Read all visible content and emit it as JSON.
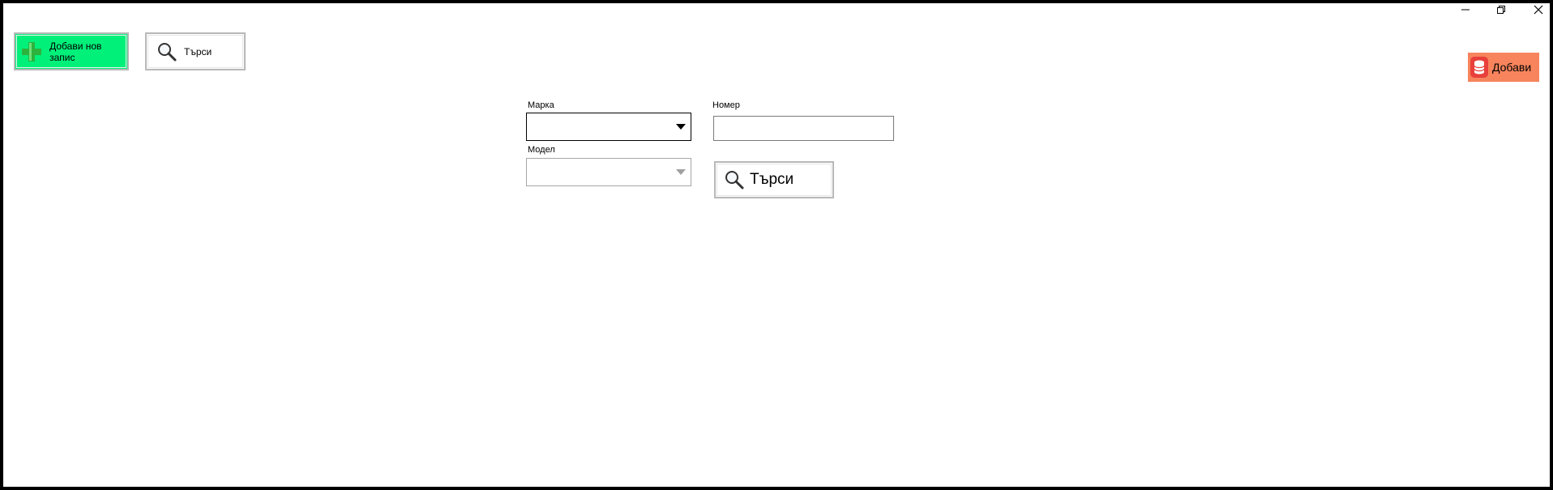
{
  "window": {
    "controls": {
      "minimize": "–",
      "restore": "❐",
      "close": "✕"
    }
  },
  "toolbar": {
    "add_record_label": "Добави нов запис",
    "search_label": "Търси"
  },
  "add_button": {
    "label": "Добави"
  },
  "form": {
    "brand": {
      "label": "Марка",
      "value": ""
    },
    "number": {
      "label": "Номер",
      "value": ""
    },
    "model": {
      "label": "Модел",
      "value": ""
    },
    "search_label": "Търси"
  },
  "colors": {
    "add_record_bg": "#00f07a",
    "add_db_bg": "#f7845c",
    "db_icon": "#e8403a"
  },
  "icons": {
    "add_record": "plus-icon",
    "search": "magnifier-icon",
    "database": "database-icon",
    "dropdown": "chevron-down-icon"
  }
}
